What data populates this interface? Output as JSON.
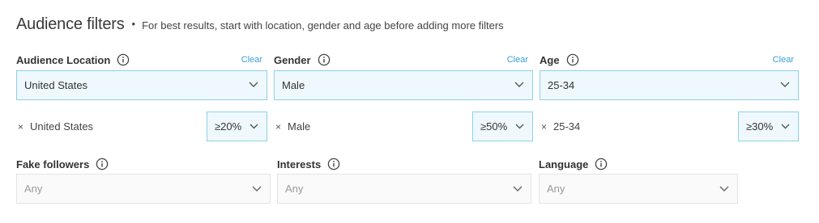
{
  "header": {
    "title": "Audience filters",
    "bullet": "•",
    "subtitle": "For best results, start with location, gender and age before adding more filters"
  },
  "filters": [
    {
      "label": "Audience Location",
      "clear_label": "Clear",
      "selected": "United States",
      "chip": "United States",
      "chip_remove": "×",
      "threshold": "≥20%"
    },
    {
      "label": "Gender",
      "clear_label": "Clear",
      "selected": "Male",
      "chip": "Male",
      "chip_remove": "×",
      "threshold": "≥50%"
    },
    {
      "label": "Age",
      "clear_label": "Clear",
      "selected": "25-34",
      "chip": "25-34",
      "chip_remove": "×",
      "threshold": "≥30%"
    }
  ],
  "secondary_filters": [
    {
      "label": "Fake followers",
      "placeholder": "Any"
    },
    {
      "label": "Interests",
      "placeholder": "Any"
    },
    {
      "label": "Language",
      "placeholder": "Any"
    }
  ],
  "colors": {
    "accent": "#3aa0d8",
    "border": "#8fd0ea",
    "fill": "#eef8fd"
  },
  "icons": {
    "info": "info-circle-icon",
    "chevron": "chevron-down-icon",
    "remove": "close-icon"
  }
}
